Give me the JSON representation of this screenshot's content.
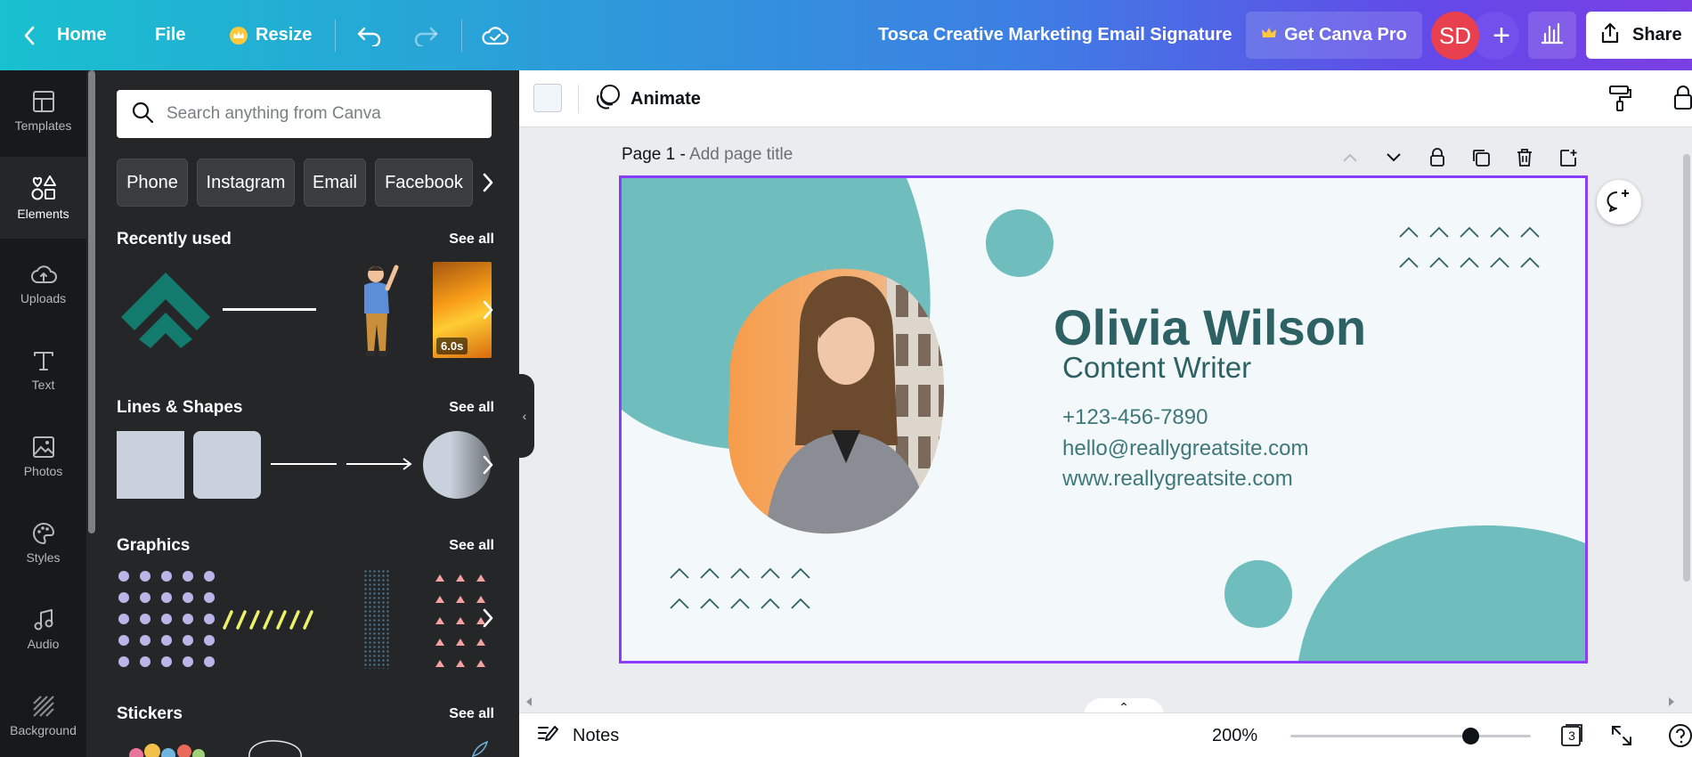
{
  "topbar": {
    "home_label": "Home",
    "file_label": "File",
    "resize_label": "Resize",
    "doc_title": "Tosca Creative Marketing Email Signature",
    "get_pro_label": "Get Canva Pro",
    "avatar_initials": "SD",
    "add_label": "+",
    "share_label": "Share"
  },
  "rail": {
    "items": [
      {
        "label": "Templates",
        "icon": "templates-icon"
      },
      {
        "label": "Elements",
        "icon": "elements-icon"
      },
      {
        "label": "Uploads",
        "icon": "uploads-icon"
      },
      {
        "label": "Text",
        "icon": "text-icon"
      },
      {
        "label": "Photos",
        "icon": "photos-icon"
      },
      {
        "label": "Styles",
        "icon": "styles-icon"
      },
      {
        "label": "Audio",
        "icon": "audio-icon"
      },
      {
        "label": "Background",
        "icon": "background-icon"
      }
    ],
    "active": "Elements"
  },
  "panel": {
    "search_placeholder": "Search anything from Canva",
    "chips": [
      "Phone",
      "Instagram",
      "Email",
      "Facebook"
    ],
    "sections": {
      "recently_used": {
        "title": "Recently used",
        "see_all": "See all",
        "video_duration": "6.0s"
      },
      "lines_shapes": {
        "title": "Lines & Shapes",
        "see_all": "See all"
      },
      "graphics": {
        "title": "Graphics",
        "see_all": "See all"
      },
      "stickers": {
        "title": "Stickers",
        "see_all": "See all"
      }
    }
  },
  "editor": {
    "animate_label": "Animate",
    "page_label": "Page 1 -",
    "page_title_placeholder": "Add page title"
  },
  "design": {
    "name": "Olivia Wilson",
    "role": "Content Writer",
    "phone": "+123-456-7890",
    "email": "hello@reallygreatsite.com",
    "website": "www.reallygreatsite.com",
    "colors": {
      "accent": "#6fbdbd",
      "text": "#2d6163",
      "background": "#f3f8fa",
      "selection": "#8b3dff"
    }
  },
  "bottombar": {
    "notes_label": "Notes",
    "zoom_label": "200%",
    "zoom_level": 0.75,
    "pages_count": "3"
  }
}
